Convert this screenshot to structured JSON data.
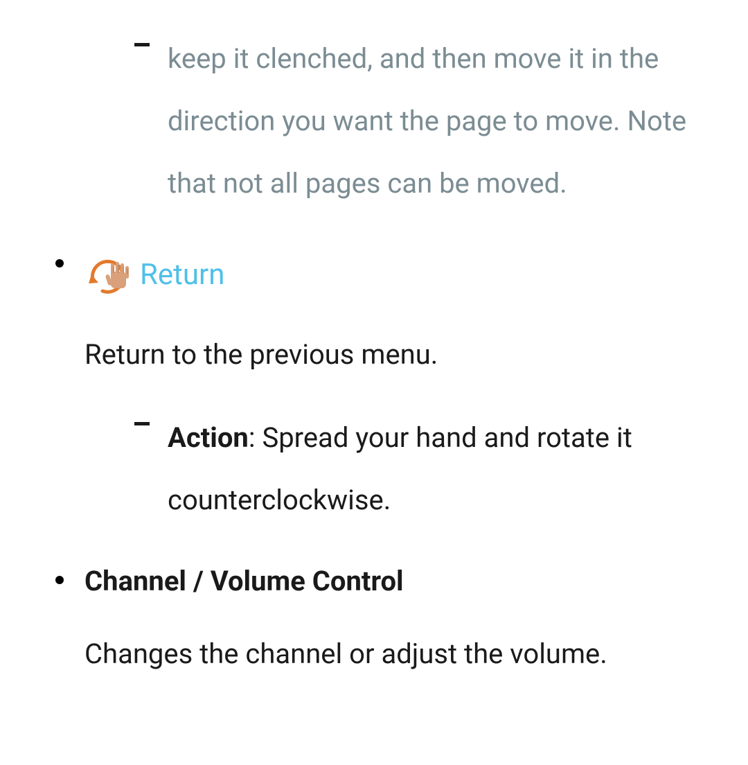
{
  "items": [
    {
      "continuation_text": "keep it clenched, and then move it in the direction you want the page to move. Note that not all pages can be moved."
    },
    {
      "title": "Return",
      "description": "Return to the previous menu.",
      "action_label": "Action",
      "action_text": ": Spread your hand and rotate it counterclockwise."
    },
    {
      "title": "Channel / Volume Control",
      "description": "Changes the channel or adjust the volume."
    }
  ]
}
